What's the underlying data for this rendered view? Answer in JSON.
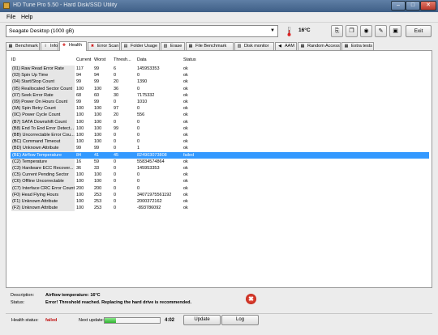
{
  "window": {
    "title": "HD Tune Pro 5.50 - Hard Disk/SSD Utility",
    "min_glyph": "–",
    "max_glyph": "□",
    "close_glyph": "✕"
  },
  "menu": [
    {
      "label": "File"
    },
    {
      "label": "Help"
    }
  ],
  "toolbar": {
    "drive": "Seagate Desktop (1000 gB)",
    "temperature": "16°C",
    "exit_label": "Exit",
    "buttons": [
      {
        "icon": "copy-icon",
        "glyph": "⎘"
      },
      {
        "icon": "copy-all-icon",
        "glyph": "❐"
      },
      {
        "icon": "screenshot-icon",
        "glyph": "◉"
      },
      {
        "icon": "options-icon",
        "glyph": "✎"
      },
      {
        "icon": "save-icon",
        "glyph": "▣"
      }
    ]
  },
  "tabs": [
    {
      "label": "Benchmark",
      "glyph": "▦"
    },
    {
      "label": "Info",
      "glyph": "i"
    },
    {
      "label": "Health",
      "glyph": "✚"
    },
    {
      "label": "Error Scan",
      "glyph": "✖"
    },
    {
      "label": "Folder Usage",
      "glyph": "▤"
    },
    {
      "label": "Erase",
      "glyph": "▧"
    },
    {
      "label": "File Benchmark",
      "glyph": "▦"
    },
    {
      "label": "Disk monitor",
      "glyph": "▥"
    },
    {
      "label": "AAM",
      "glyph": "◀"
    },
    {
      "label": "Random Access",
      "glyph": "▦"
    },
    {
      "label": "Extra tests",
      "glyph": "▦"
    }
  ],
  "table": {
    "headers": [
      "ID",
      "Current",
      "Worst",
      "Thresh...",
      "Data",
      "Status"
    ],
    "rows": [
      [
        "(01) Raw Read Error Rate",
        "117",
        "99",
        "6",
        "145953353",
        "ok"
      ],
      [
        "(03) Spin Up Time",
        "94",
        "94",
        "0",
        "0",
        "ok"
      ],
      [
        "(04) Start/Stop Count",
        "99",
        "99",
        "20",
        "1390",
        "ok"
      ],
      [
        "(05) Reallocated Sector Count",
        "100",
        "100",
        "36",
        "0",
        "ok"
      ],
      [
        "(07) Seek Error Rate",
        "68",
        "60",
        "30",
        "7175332",
        "ok"
      ],
      [
        "(09) Power On Hours Count",
        "99",
        "99",
        "0",
        "1010",
        "ok"
      ],
      [
        "(0A) Spin Retry Count",
        "100",
        "100",
        "97",
        "0",
        "ok"
      ],
      [
        "(0C) Power Cycle Count",
        "100",
        "100",
        "20",
        "556",
        "ok"
      ],
      [
        "(B7) SATA Downshift Count",
        "100",
        "100",
        "0",
        "0",
        "ok"
      ],
      [
        "(B8) End To End Error Detect...",
        "100",
        "100",
        "99",
        "0",
        "ok"
      ],
      [
        "(BB) Uncorrectable Error Cou...",
        "100",
        "100",
        "0",
        "0",
        "ok"
      ],
      [
        "(BC) Command Timeout",
        "100",
        "100",
        "0",
        "0",
        "ok"
      ],
      [
        "(BD) Unknown Attribute",
        "99",
        "99",
        "0",
        "1",
        "ok"
      ],
      [
        "(BE) Airflow Temperature",
        "84",
        "41",
        "45",
        "824903073808",
        "failed"
      ],
      [
        "(C2) Temperature",
        "16",
        "59",
        "0",
        "55834574864",
        "ok"
      ],
      [
        "(C3) Hardware ECC Recover...",
        "36",
        "33",
        "0",
        "145953353",
        "ok"
      ],
      [
        "(C5) Current Pending Sector",
        "100",
        "100",
        "0",
        "0",
        "ok"
      ],
      [
        "(C6) Offline Uncorrectable",
        "100",
        "100",
        "0",
        "0",
        "ok"
      ],
      [
        "(C7) Interface CRC Error Count",
        "200",
        "200",
        "0",
        "0",
        "ok"
      ],
      [
        "(F0) Head Flying Hours",
        "100",
        "253",
        "0",
        "34071975561192",
        "ok"
      ],
      [
        "(F1) Unknown Attribute",
        "100",
        "253",
        "0",
        "2000372162",
        "ok"
      ],
      [
        "(F2) Unknown Attribute",
        "100",
        "253",
        "0",
        "-893786092",
        "ok"
      ]
    ],
    "selected_row": 13
  },
  "description": {
    "desc_label": "Description:",
    "desc_value": "Airflow temperature: 16°C",
    "status_label": "Status:",
    "status_value": "Error! Threshold reached. Replacing the hard drive is recommended.",
    "error_glyph": "✖"
  },
  "status": {
    "health_label": "Health status:",
    "health_value": "failed",
    "next_update_label": "Next update:",
    "progress": 0.2,
    "next_update_time": "4:02",
    "update_label": "Update",
    "log_label": "Log"
  },
  "colors": {
    "selection": "#3399ff",
    "failed": "#c01010",
    "progress": "#2fb32f"
  }
}
